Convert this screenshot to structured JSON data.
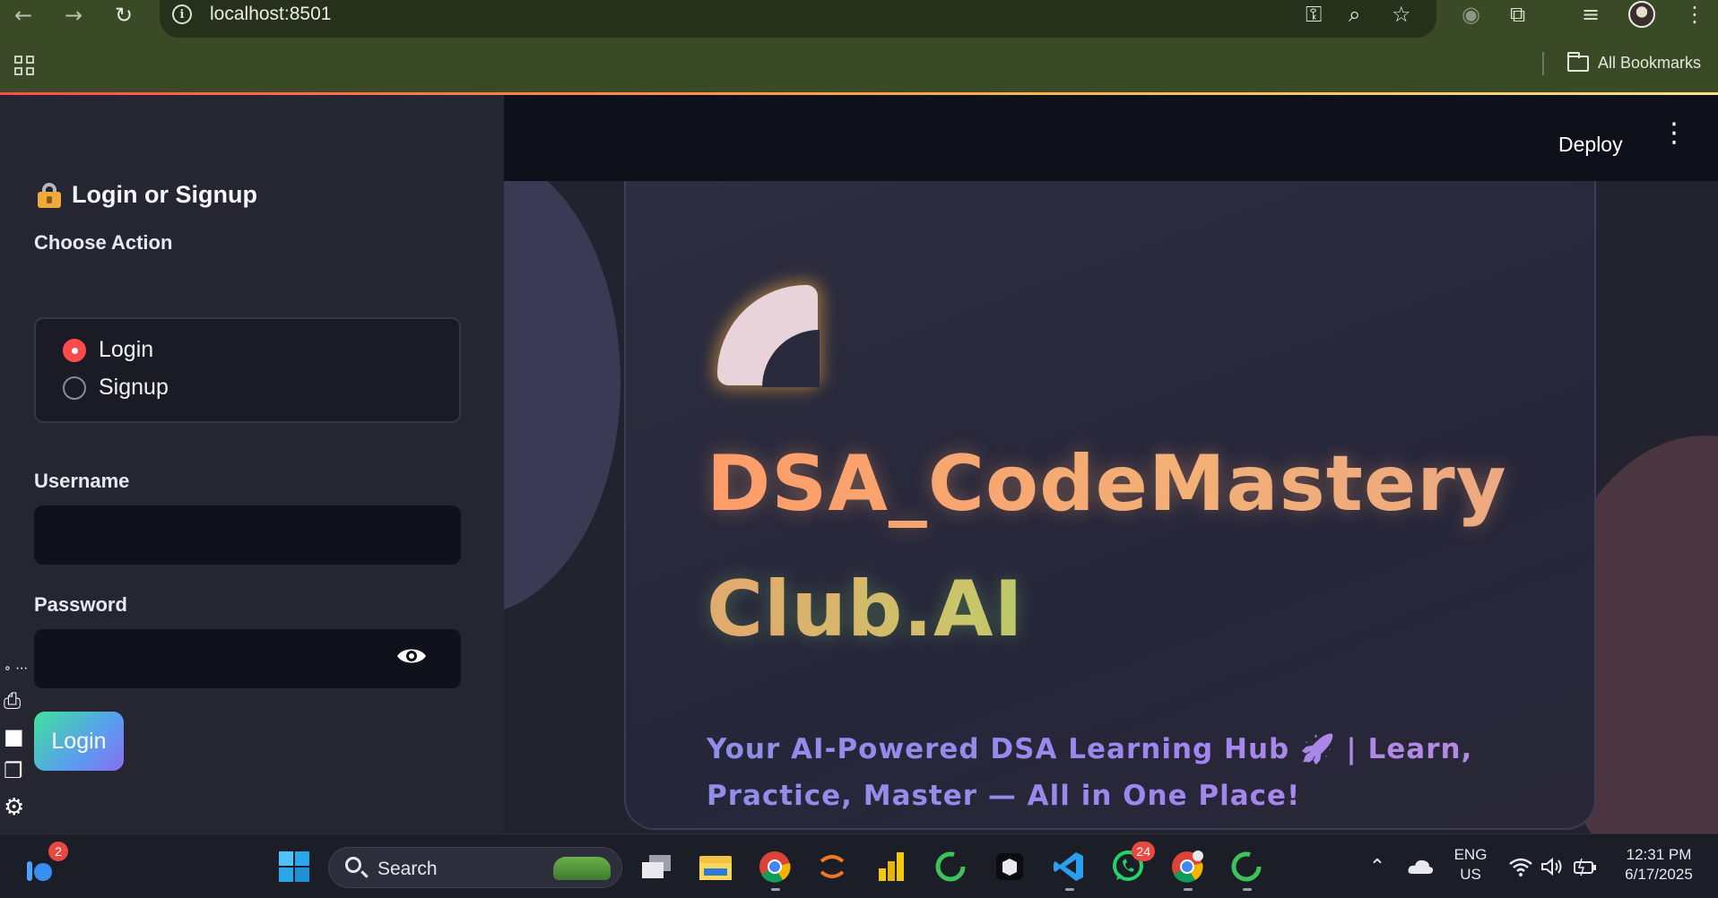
{
  "browser": {
    "url": "localhost:8501",
    "bookmarks_label": "All Bookmarks"
  },
  "app": {
    "deploy_label": "Deploy"
  },
  "sidebar": {
    "title": "Login or Signup",
    "choose_action_label": "Choose Action",
    "radio_options": [
      {
        "label": "Login",
        "selected": true
      },
      {
        "label": "Signup",
        "selected": false
      }
    ],
    "username_label": "Username",
    "username_value": "",
    "password_label": "Password",
    "password_value": "",
    "login_button": "Login"
  },
  "hero": {
    "title_line1": "DSA_CodeMastery",
    "title_line2": "Club.AI",
    "subtitle_line1": "Your AI-Powered DSA Learning Hub 🚀 | Learn,",
    "subtitle_line2": "Practice, Master — All in One Place!"
  },
  "taskbar": {
    "widgets_badge": "2",
    "search_label": "Search",
    "whatsapp_badge": "24",
    "language_line1": "ENG",
    "language_line2": "US",
    "time": "12:31 PM",
    "date": "6/17/2025"
  },
  "colors": {
    "accent_red": "#ff4b4b",
    "sidebar_bg": "#262633",
    "topbar_bg": "#0e1119"
  }
}
